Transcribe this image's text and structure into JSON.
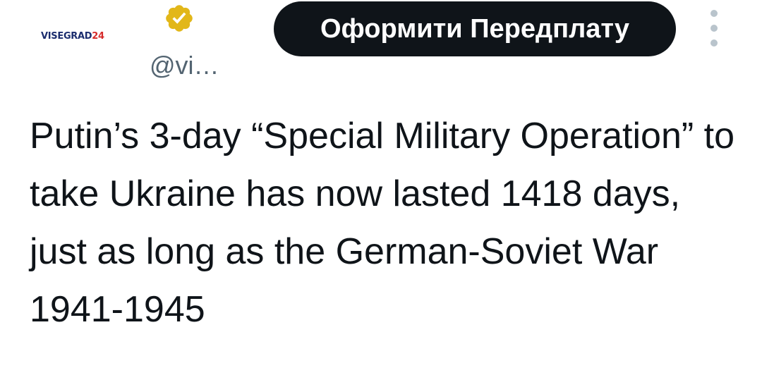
{
  "header": {
    "logo_text": "VISEGRAD",
    "logo_number": "24",
    "handle": "@vi…",
    "verified_icon": "verified-badge-icon",
    "subscribe_label": "Оформити Передплату",
    "more_icon": "more-vertical-icon"
  },
  "tweet": {
    "text": "Putin’s 3-day “Special Military Operation” to take Ukraine has now lasted 1418 days, just as long as the German-Soviet War 1941-1945"
  },
  "colors": {
    "text": "#0f1419",
    "secondary": "#536471",
    "button_bg": "#0f1419",
    "verified_gold": "#e2b719"
  }
}
